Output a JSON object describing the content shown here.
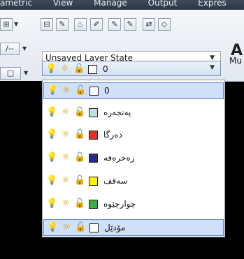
{
  "menubar": {
    "items": [
      "ametric",
      "View",
      "Manage",
      "Output",
      "Expres"
    ]
  },
  "ribbon": {
    "layer_state_value": "Unsaved Layer State",
    "side_text_top": "Mu",
    "big_letter": "A"
  },
  "current_layer": {
    "name": "0",
    "color": "#ffffff"
  },
  "layers": [
    {
      "name": "0",
      "color": "#ffffff",
      "selected": true
    },
    {
      "name": "پەنجەرە",
      "color": "#bde3e1",
      "selected": false
    },
    {
      "name": "دەرگا",
      "color": "#e0302a",
      "selected": false
    },
    {
      "name": "زەخرەفە",
      "color": "#2c2b8c",
      "selected": false
    },
    {
      "name": "سەقف",
      "color": "#ffee00",
      "selected": false
    },
    {
      "name": "چوارچێوە",
      "color": "#3cb043",
      "selected": false
    },
    {
      "name": "مۆدێل",
      "color": "#ffffff",
      "selected": true
    }
  ],
  "icons": {
    "on": "lightbulb-icon",
    "thaw": "sun-icon",
    "lock": "unlock-icon"
  }
}
